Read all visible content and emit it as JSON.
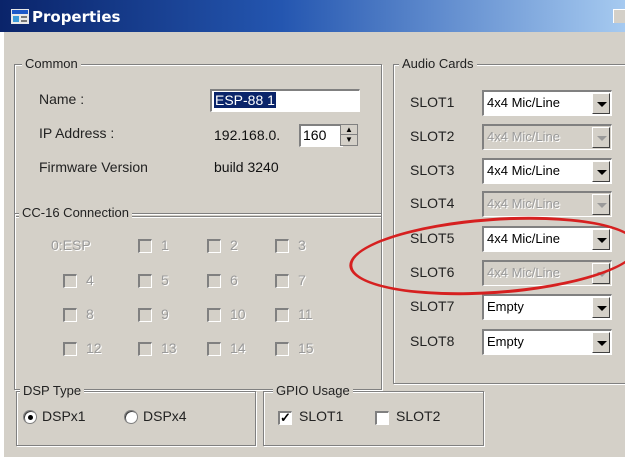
{
  "window": {
    "title": "Properties"
  },
  "common": {
    "legend": "Common",
    "name_label": "Name :",
    "name_value": "ESP-88 1",
    "ip_label": "IP Address :",
    "ip_prefix": "192.168.0.",
    "ip_last": "160",
    "firmware_label": "Firmware Version",
    "firmware_value": "build  3240"
  },
  "cc16": {
    "legend": "CC-16 Connection",
    "esp_label": "0:ESP",
    "boxes": [
      "1",
      "2",
      "3",
      "4",
      "5",
      "6",
      "7",
      "8",
      "9",
      "10",
      "11",
      "12",
      "13",
      "14",
      "15"
    ]
  },
  "audio_cards": {
    "legend": "Audio Cards",
    "slots": [
      {
        "label": "SLOT1",
        "value": "4x4 Mic/Line",
        "enabled": true
      },
      {
        "label": "SLOT2",
        "value": "4x4 Mic/Line",
        "enabled": false
      },
      {
        "label": "SLOT3",
        "value": "4x4 Mic/Line",
        "enabled": true
      },
      {
        "label": "SLOT4",
        "value": "4x4 Mic/Line",
        "enabled": false
      },
      {
        "label": "SLOT5",
        "value": "4x4 Mic/Line",
        "enabled": true
      },
      {
        "label": "SLOT6",
        "value": "4x4 Mic/Line",
        "enabled": false
      },
      {
        "label": "SLOT7",
        "value": "Empty",
        "enabled": true
      },
      {
        "label": "SLOT8",
        "value": "Empty",
        "enabled": true
      }
    ]
  },
  "dsp_type": {
    "legend": "DSP Type",
    "options": [
      {
        "label": "DSPx1",
        "selected": true
      },
      {
        "label": "DSPx4",
        "selected": false
      }
    ]
  },
  "gpio_usage": {
    "legend": "GPIO Usage",
    "options": [
      {
        "label": "SLOT1",
        "checked": true
      },
      {
        "label": "SLOT2",
        "checked": false
      }
    ]
  },
  "colors": {
    "title_start": "#0a246a",
    "title_end": "#a6caf0",
    "face": "#d4d0c8",
    "annotation": "#d62020"
  },
  "icons": {
    "window_icon": "properties-window-icon"
  }
}
